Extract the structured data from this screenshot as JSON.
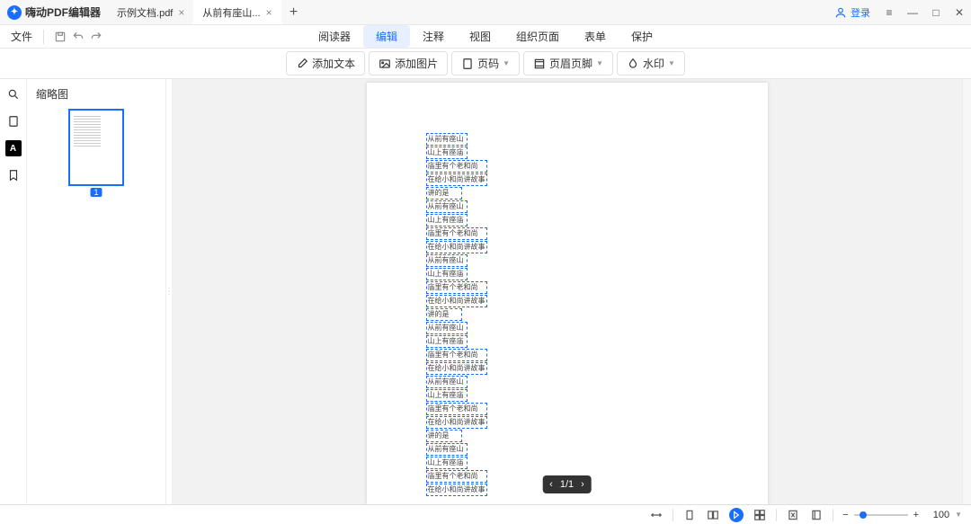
{
  "app": {
    "name": "嗨动PDF编辑器"
  },
  "tabs": [
    {
      "label": "示例文档.pdf",
      "active": false
    },
    {
      "label": "从前有座山...",
      "active": true
    }
  ],
  "login_label": "登录",
  "file_menu": "文件",
  "main_tabs": {
    "reader": "阅读器",
    "edit": "编辑",
    "annotate": "注释",
    "view": "视图",
    "organize": "组织页面",
    "form": "表单",
    "protect": "保护"
  },
  "tools": {
    "add_text": "添加文本",
    "add_image": "添加图片",
    "page_number": "页码",
    "header_footer": "页眉页脚",
    "watermark": "水印"
  },
  "thumb_panel_title": "缩略图",
  "thumb_page_num": "1",
  "page_nav": {
    "current": "1",
    "total": "1",
    "display": "1/1"
  },
  "zoom": "100",
  "text_blocks": [
    "从前有座山",
    "山上有座庙",
    "庙里有个老和尚",
    "在给小和尚讲故事",
    "讲的是",
    "从前有座山",
    "山上有座庙",
    "庙里有个老和尚",
    "在给小和尚讲故事",
    "从前有座山",
    "山上有座庙",
    "庙里有个老和尚",
    "在给小和尚讲故事",
    "讲的是",
    "从前有座山",
    "山上有座庙",
    "庙里有个老和尚",
    "在给小和尚讲故事",
    "从前有座山",
    "山上有座庙",
    "庙里有个老和尚",
    "在给小和尚讲故事",
    "讲的是",
    "从前有座山",
    "山上有座庙",
    "庙里有个老和尚",
    "在给小和尚讲故事"
  ],
  "block_widths": [
    "w1",
    "w1",
    "w2",
    "w2",
    "w3",
    "w1",
    "w1",
    "w2",
    "w2",
    "w1",
    "w1",
    "w2",
    "w2",
    "w3",
    "w1",
    "w1",
    "w2",
    "w2",
    "w1",
    "w1",
    "w2",
    "w2",
    "w3",
    "w1",
    "w1",
    "w2",
    "w2"
  ]
}
